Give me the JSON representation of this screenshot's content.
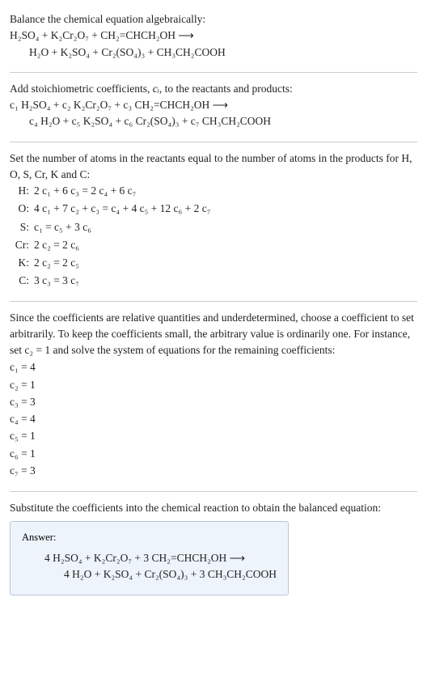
{
  "intro": {
    "title": "Balance the chemical equation algebraically:",
    "eq_line1": "H₂SO₄ + K₂Cr₂O₇ + CH₂=CHCH₂OH ⟶",
    "eq_line2": "H₂O + K₂SO₄ + Cr₂(SO₄)₃ + CH₃CH₂COOH"
  },
  "step1": {
    "text_a": "Add stoichiometric coefficients, ",
    "ci": "cᵢ",
    "text_b": ", to the reactants and products:",
    "eq_line1": "c₁ H₂SO₄ + c₂ K₂Cr₂O₇ + c₃ CH₂=CHCH₂OH ⟶",
    "eq_line2": "c₄ H₂O + c₅ K₂SO₄ + c₆ Cr₂(SO₄)₃ + c₇ CH₃CH₂COOH"
  },
  "step2": {
    "text": "Set the number of atoms in the reactants equal to the number of atoms in the products for H, O, S, Cr, K and C:",
    "rows": [
      {
        "el": "H:",
        "eq": "2 c₁ + 6 c₃ = 2 c₄ + 6 c₇"
      },
      {
        "el": "O:",
        "eq": "4 c₁ + 7 c₂ + c₃ = c₄ + 4 c₅ + 12 c₆ + 2 c₇"
      },
      {
        "el": "S:",
        "eq": "c₁ = c₅ + 3 c₆"
      },
      {
        "el": "Cr:",
        "eq": "2 c₂ = 2 c₆"
      },
      {
        "el": "K:",
        "eq": "2 c₂ = 2 c₅"
      },
      {
        "el": "C:",
        "eq": "3 c₃ = 3 c₇"
      }
    ]
  },
  "step3": {
    "text": "Since the coefficients are relative quantities and underdetermined, choose a coefficient to set arbitrarily. To keep the coefficients small, the arbitrary value is ordinarily one. For instance, set c₂ = 1 and solve the system of equations for the remaining coefficients:",
    "coeffs": [
      "c₁ = 4",
      "c₂ = 1",
      "c₃ = 3",
      "c₄ = 4",
      "c₅ = 1",
      "c₆ = 1",
      "c₇ = 3"
    ]
  },
  "step4": {
    "text": "Substitute the coefficients into the chemical reaction to obtain the balanced equation:",
    "answer_label": "Answer:",
    "ans_line1": "4 H₂SO₄ + K₂Cr₂O₇ + 3 CH₂=CHCH₂OH ⟶",
    "ans_line2": "4 H₂O + K₂SO₄ + Cr₂(SO₄)₃ + 3 CH₃CH₂COOH"
  }
}
